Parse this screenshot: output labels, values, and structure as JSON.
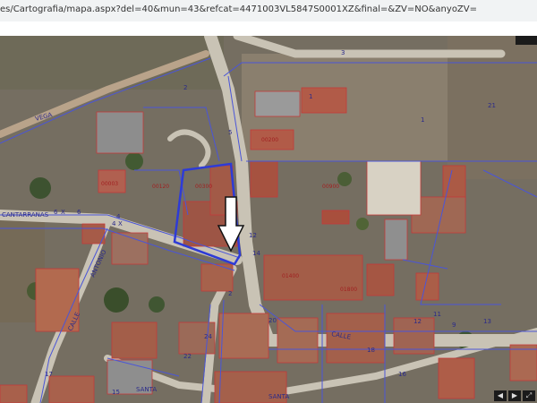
{
  "browser": {
    "url": "es/Cartografia/mapa.aspx?del=40&mun=43&refcat=4471003VL5847S0001XZ&final=&ZV=NO&anyoZV="
  },
  "map": {
    "parcel_numbers": [
      "3",
      "1",
      "1",
      "21",
      "2",
      "5",
      "12",
      "14",
      "18",
      "11",
      "9",
      "4",
      "6",
      "20",
      "17",
      "22",
      "24",
      "15",
      "16"
    ],
    "building_refs": [
      "00200",
      "00300",
      "00003",
      "00120",
      "00900",
      "01400",
      "01800"
    ],
    "street_labels": [
      "VEGA",
      "CANTARRANAS",
      "ANTONIO",
      "CALLE",
      "CALLE",
      "SANTA",
      "SANTA"
    ],
    "numbers_misc": [
      "6",
      "X",
      "4",
      "X",
      "2",
      "13",
      "12"
    ],
    "controls": [
      "◀",
      "▶",
      "⤢"
    ]
  }
}
